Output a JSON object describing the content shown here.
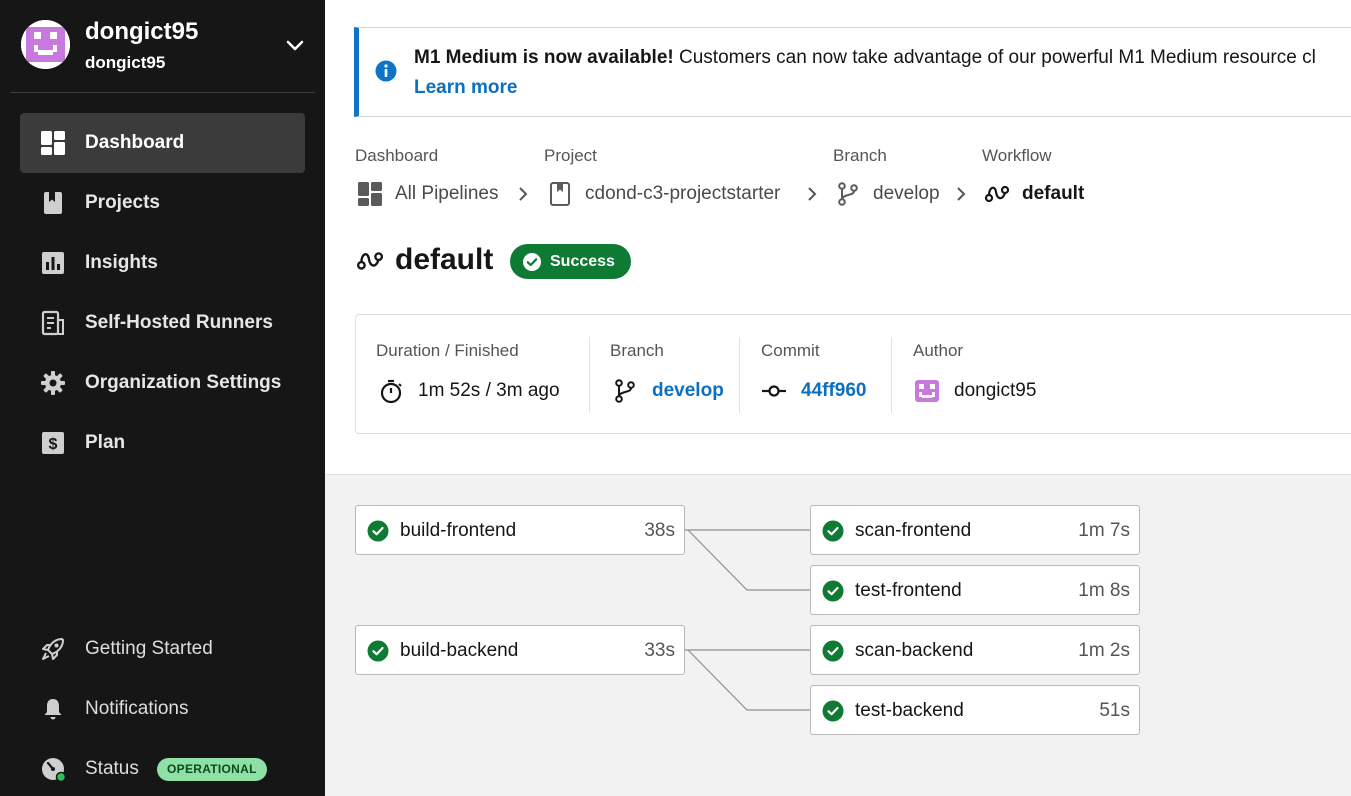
{
  "org": {
    "name": "dongict95",
    "sub": "dongict95"
  },
  "nav": {
    "top": [
      {
        "label": "Dashboard",
        "icon": "dashboard-icon",
        "active": true
      },
      {
        "label": "Projects",
        "icon": "bookmark-icon"
      },
      {
        "label": "Insights",
        "icon": "bar-chart-icon"
      },
      {
        "label": "Self-Hosted Runners",
        "icon": "runner-icon"
      },
      {
        "label": "Organization Settings",
        "icon": "gear-icon"
      },
      {
        "label": "Plan",
        "icon": "dollar-icon"
      }
    ],
    "bottom": [
      {
        "label": "Getting Started",
        "icon": "rocket-icon"
      },
      {
        "label": "Notifications",
        "icon": "bell-icon"
      },
      {
        "label": "Status",
        "icon": "gauge-icon"
      }
    ],
    "status_badge": "OPERATIONAL"
  },
  "banner": {
    "title": "M1 Medium is now available!",
    "text": " Customers can now take advantage of our powerful M1 Medium resource cl",
    "link": "Learn more"
  },
  "breadcrumb": {
    "headers": [
      "Dashboard",
      "Project",
      "Branch",
      "Workflow"
    ],
    "items": [
      "All Pipelines",
      "cdond-c3-projectstarter",
      "develop",
      "default"
    ]
  },
  "workflow": {
    "title": "default",
    "status": "Success"
  },
  "details": {
    "duration_label": "Duration / Finished",
    "duration_value": "1m 52s / 3m ago",
    "branch_label": "Branch",
    "branch_value": "develop",
    "commit_label": "Commit",
    "commit_value": "44ff960",
    "author_label": "Author",
    "author_value": "dongict95"
  },
  "jobs": [
    {
      "name": "build-frontend",
      "duration": "38s"
    },
    {
      "name": "scan-frontend",
      "duration": "1m 7s"
    },
    {
      "name": "test-frontend",
      "duration": "1m 8s"
    },
    {
      "name": "build-backend",
      "duration": "33s"
    },
    {
      "name": "scan-backend",
      "duration": "1m 2s"
    },
    {
      "name": "test-backend",
      "duration": "51s"
    }
  ],
  "colors": {
    "success": "#0e7a33",
    "link": "#0d6fbf",
    "sidebar": "#161616",
    "avatar": "#c779e0",
    "info": "#0d74c7"
  }
}
